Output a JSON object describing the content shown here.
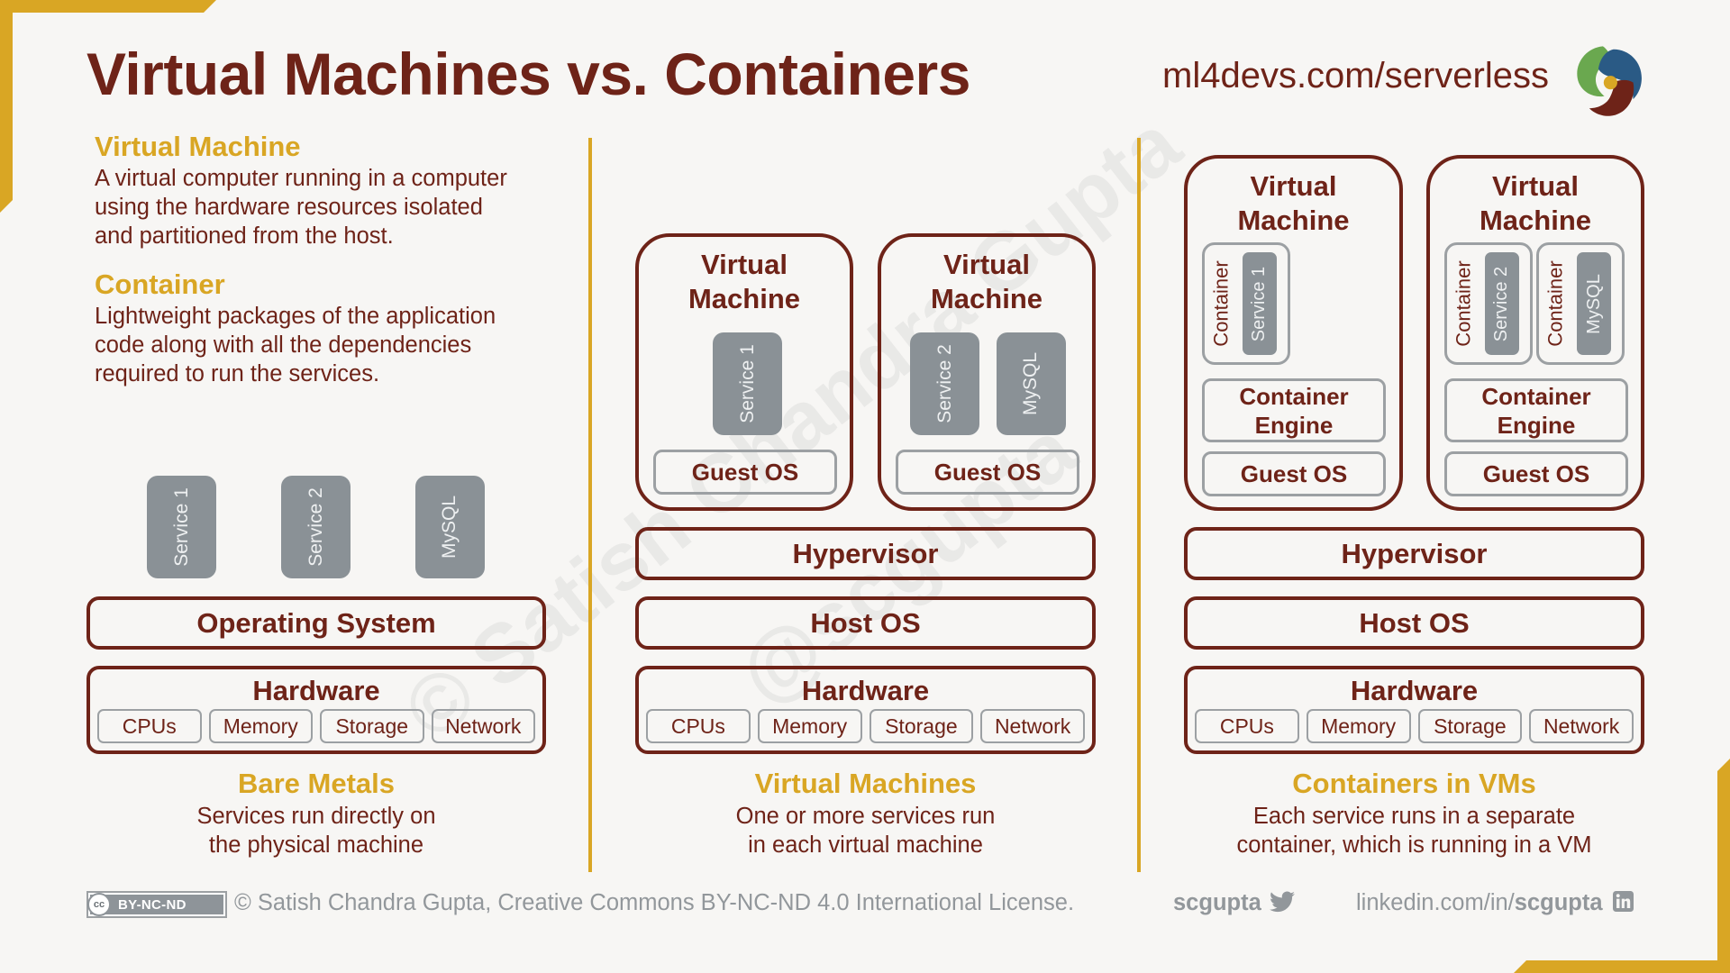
{
  "header": {
    "title": "Virtual Machines vs. Containers",
    "url": "ml4devs.com/serverless",
    "logo_icon": "pinwheel-logo-icon",
    "logo_colors": [
      "#6aa84f",
      "#2a5a85",
      "#6e2318",
      "#d9a624"
    ]
  },
  "colors": {
    "accent": "#d9a624",
    "primary": "#6e2318",
    "service_fill": "#8a9196",
    "inner_border": "#9ca0a3",
    "footer_text": "#92979b"
  },
  "definitions": [
    {
      "heading": "Virtual Machine",
      "lines": [
        "A virtual computer running in a computer",
        "using the hardware resources isolated",
        "and partitioned from the host."
      ]
    },
    {
      "heading": "Container",
      "lines": [
        "Lightweight packages of the application",
        "code along with all the dependencies",
        "required to run the services."
      ]
    }
  ],
  "hardware_items": [
    "CPUs",
    "Memory",
    "Storage",
    "Network"
  ],
  "bare_metal": {
    "services": [
      "Service 1",
      "Service 2",
      "MySQL"
    ],
    "os": "Operating System",
    "hardware": "Hardware",
    "caption_title": "Bare Metals",
    "caption_lines": [
      "Services run directly on",
      "the physical machine"
    ]
  },
  "virtual_machines": {
    "vms": [
      {
        "title_lines": [
          "Virtual",
          "Machine"
        ],
        "services": [
          "Service 1"
        ],
        "guest_os": "Guest OS"
      },
      {
        "title_lines": [
          "Virtual",
          "Machine"
        ],
        "services": [
          "Service 2",
          "MySQL"
        ],
        "guest_os": "Guest OS"
      }
    ],
    "hypervisor": "Hypervisor",
    "host_os": "Host OS",
    "hardware": "Hardware",
    "caption_title": "Virtual Machines",
    "caption_lines": [
      "One or more services run",
      "in each virtual machine"
    ]
  },
  "containers_in_vms": {
    "vms": [
      {
        "title_lines": [
          "Virtual",
          "Machine"
        ],
        "containers": [
          {
            "label": "Container",
            "service": "Service 1"
          }
        ],
        "engine_lines": [
          "Container",
          "Engine"
        ],
        "guest_os": "Guest OS"
      },
      {
        "title_lines": [
          "Virtual",
          "Machine"
        ],
        "containers": [
          {
            "label": "Container",
            "service": "Service 2"
          },
          {
            "label": "Container",
            "service": "MySQL"
          }
        ],
        "engine_lines": [
          "Container",
          "Engine"
        ],
        "guest_os": "Guest OS"
      }
    ],
    "hypervisor": "Hypervisor",
    "host_os": "Host OS",
    "hardware": "Hardware",
    "caption_title": "Containers in VMs",
    "caption_lines": [
      "Each service runs in a separate",
      "container, which is running in a VM"
    ]
  },
  "watermark": {
    "line1": "© Satish Chandra Gupta",
    "line2": "@scgupta"
  },
  "footer": {
    "license_badge_icon": "cc-icon",
    "license_badge": "BY-NC-ND",
    "cc_glyph": "cc",
    "license_text": "© Satish Chandra Gupta, Creative Commons BY-NC-ND 4.0 International License.",
    "twitter_handle": "scgupta",
    "twitter_icon": "twitter-bird-icon",
    "linkedin_prefix": "linkedin.com/in/",
    "linkedin_handle": "scgupta",
    "linkedin_icon": "linkedin-icon"
  }
}
